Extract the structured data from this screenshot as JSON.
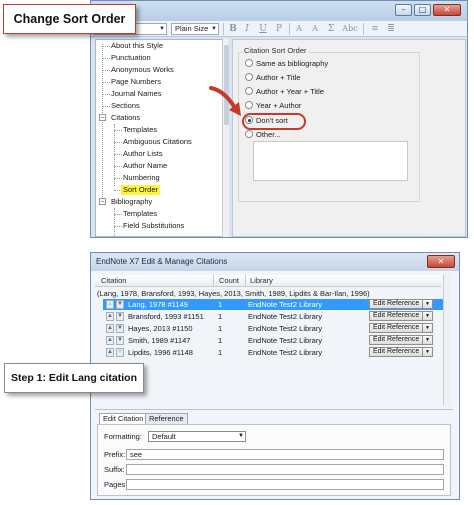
{
  "callouts": {
    "top": "Change Sort Order",
    "bottom": "Step 1: Edit Lang citation"
  },
  "style_editor": {
    "toolbar": {
      "font_size_value": "Plain Size",
      "format_glyphs": [
        "B",
        "I",
        "U",
        "P",
        "A",
        "A",
        "Σ",
        "Abc"
      ]
    },
    "window_buttons": [
      "minimize-icon",
      "maximize-icon",
      "close-icon"
    ],
    "tree": {
      "top_items": [
        "About this Style",
        "Punctuation",
        "Anonymous Works",
        "Page Numbers",
        "Journal Names",
        "Sections"
      ],
      "citations_label": "Citations",
      "citations_children": [
        "Templates",
        "Ambiguous Citations",
        "Author Lists",
        "Author Name",
        "Numbering",
        "Sort Order"
      ],
      "bibliography_label": "Bibliography",
      "bibliography_children": [
        "Templates",
        "Field Substitutions"
      ],
      "selected": "Sort Order"
    },
    "sort_panel": {
      "title": "Citation Sort Order",
      "options": [
        "Same as bibliography",
        "Author + Title",
        "Author + Year + Title",
        "Year + Author",
        "Don't sort",
        "Other..."
      ],
      "selected": "Don't sort"
    }
  },
  "manage_citations": {
    "title": "EndNote X7 Edit & Manage Citations",
    "columns": [
      "Citation",
      "Count",
      "Library"
    ],
    "group_summary": "(Lang, 1978, Bransford, 1993, Hayes, 2013, Smith, 1989, Lipdits & Bar-Ilan, 1996)",
    "rows": [
      {
        "citation": "Lang, 1978 #1149",
        "count": "1",
        "library": "EndNote Test2 Library",
        "action": "Edit Reference"
      },
      {
        "citation": "Bransford, 1993 #1151",
        "count": "1",
        "library": "EndNote Test2 Library",
        "action": "Edit Reference"
      },
      {
        "citation": "Hayes, 2013 #1150",
        "count": "1",
        "library": "EndNote Test2 Library",
        "action": "Edit Reference"
      },
      {
        "citation": "Smith, 1989 #1147",
        "count": "1",
        "library": "EndNote Test2 Library",
        "action": "Edit Reference"
      },
      {
        "citation": "Lipdits, 1996 #1148",
        "count": "1",
        "library": "EndNote Test2 Library",
        "action": "Edit Reference"
      }
    ],
    "tabs": [
      "Edit Citation",
      "Reference"
    ],
    "form": {
      "formatting_label": "Formatting:",
      "formatting_value": "Default",
      "prefix_label": "Prefix:",
      "prefix_value": "see",
      "suffix_label": "Suffix:",
      "suffix_value": "",
      "pages_label": "Pages:",
      "pages_value": ""
    }
  },
  "colors": {
    "accent_red": "#c8382b",
    "selection_blue": "#3399ff",
    "highlight_yellow": "#fff23a"
  }
}
